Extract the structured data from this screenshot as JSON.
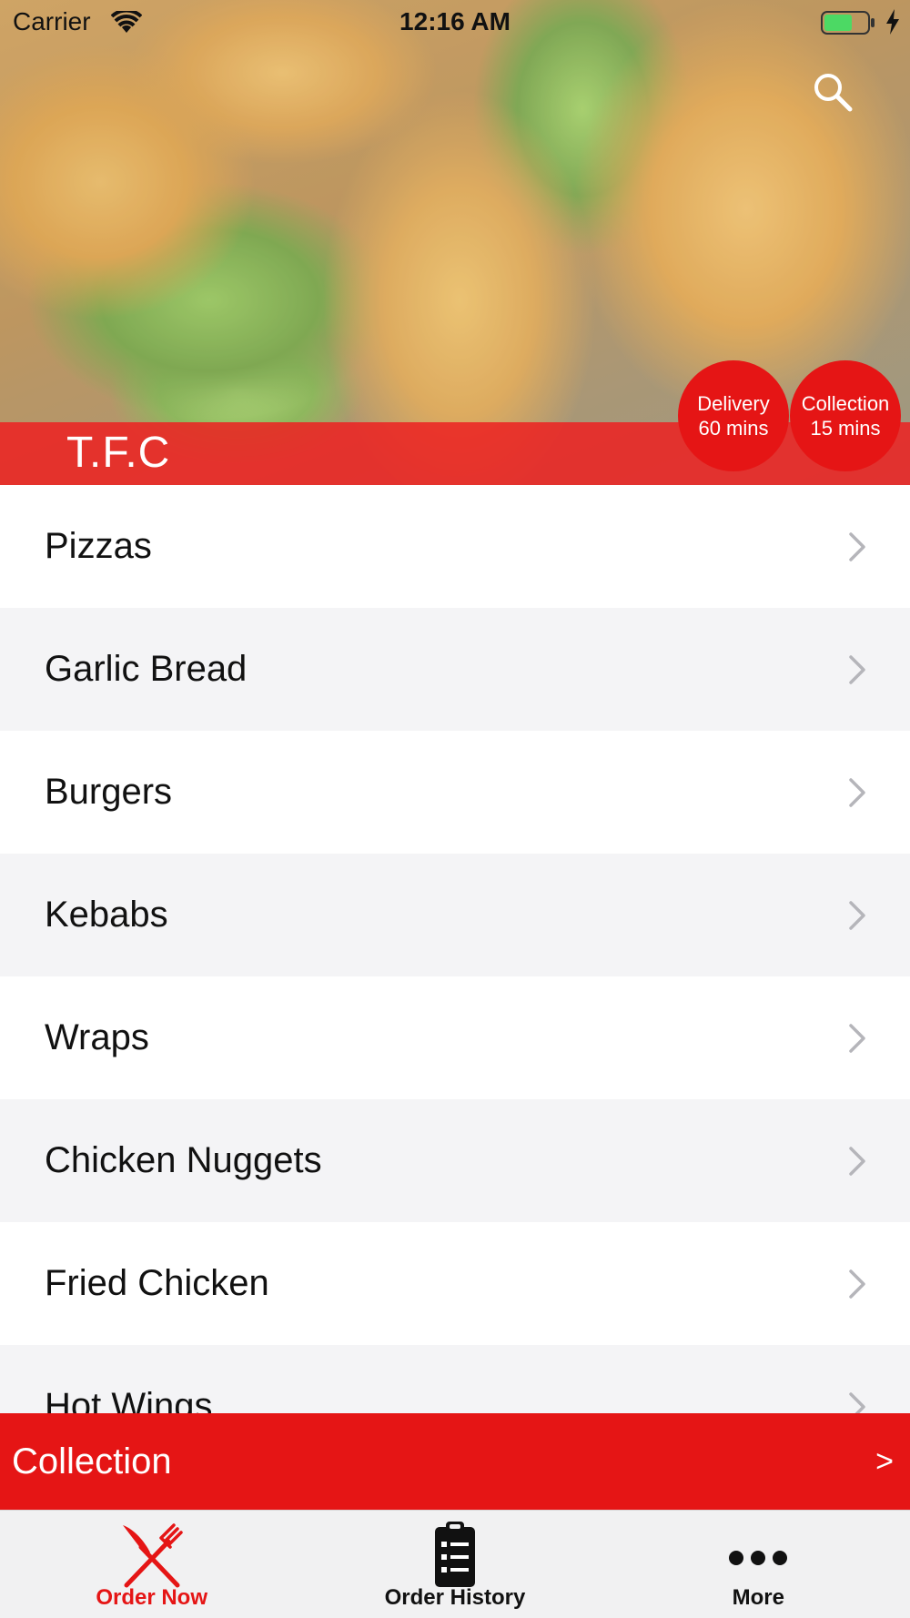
{
  "status_bar": {
    "carrier": "Carrier",
    "time": "12:16 AM",
    "icons": [
      "wifi-icon",
      "battery-icon",
      "charging-bolt-icon"
    ]
  },
  "header": {
    "restaurant_name": "T.F.C",
    "search_icon": "search-icon",
    "badges": {
      "delivery": {
        "label": "Delivery",
        "time": "60 mins"
      },
      "collection": {
        "label": "Collection",
        "time": "15 mins"
      }
    }
  },
  "categories": [
    {
      "label": "Pizzas"
    },
    {
      "label": "Garlic Bread"
    },
    {
      "label": "Burgers"
    },
    {
      "label": "Kebabs"
    },
    {
      "label": "Wraps"
    },
    {
      "label": "Chicken Nuggets"
    },
    {
      "label": "Fried Chicken"
    },
    {
      "label": "Hot Wings"
    }
  ],
  "collection_bar": {
    "label": "Collection",
    "arrow": ">"
  },
  "tab_bar": {
    "tabs": [
      {
        "label": "Order Now",
        "icon": "fork-knife-icon",
        "active": true
      },
      {
        "label": "Order History",
        "icon": "clipboard-list-icon",
        "active": false
      },
      {
        "label": "More",
        "icon": "more-dots-icon",
        "active": false
      }
    ]
  },
  "colors": {
    "accent": "#e51515",
    "title_band": "#ec2222",
    "row_alt": "#f4f4f6",
    "tab_bar_bg": "#f1f1f2"
  }
}
